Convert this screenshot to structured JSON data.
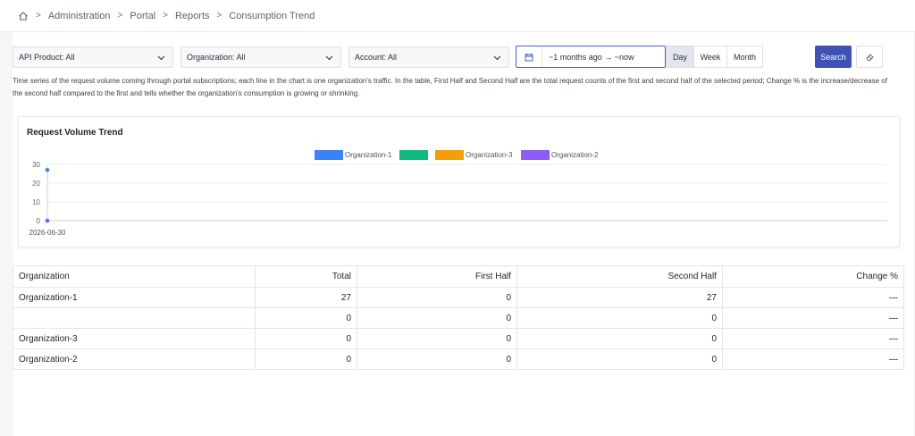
{
  "breadcrumb": {
    "home_icon": "home-icon",
    "items": [
      "Administration",
      "Portal",
      "Reports",
      "Consumption Trend"
    ]
  },
  "filters": {
    "api_product": "API Product: All",
    "organization": "Organization: All",
    "account": "Account: All",
    "date_range": "~1 months ago → ~now",
    "granularity": [
      "Day",
      "Week",
      "Month"
    ],
    "active_granularity": "Day",
    "search_label": "Search"
  },
  "description": "Time series of the request volume coming through portal subscriptions; each line in the chart is one organization's traffic. In the table, First Half and Second Half are the total request counts of the first and second half of the selected period; Change % is the increase/decrease of the second half compared to the first and tells whether the organization's consumption is growing or shrinking.",
  "chart_data": {
    "type": "line",
    "title": "Request Volume Trend",
    "x": [
      "2026-06-30"
    ],
    "yticks": [
      0,
      10,
      20,
      30
    ],
    "ylim": [
      0,
      30
    ],
    "legend_position": "top-center",
    "series": [
      {
        "name": "Organization-1",
        "values": [
          27
        ],
        "color": "#3b82f6"
      },
      {
        "name": "",
        "values": [
          0
        ],
        "color": "#10b981"
      },
      {
        "name": "Organization-3",
        "values": [
          0
        ],
        "color": "#f59e0b"
      },
      {
        "name": "Organization-2",
        "values": [
          0
        ],
        "color": "#8b5cf6"
      }
    ]
  },
  "table": {
    "headers": [
      "Organization",
      "Total",
      "First Half",
      "Second Half",
      "Change %"
    ],
    "rows": [
      [
        "Organization-1",
        "27",
        "0",
        "27",
        "—"
      ],
      [
        "",
        "0",
        "0",
        "0",
        "—"
      ],
      [
        "Organization-3",
        "0",
        "0",
        "0",
        "—"
      ],
      [
        "Organization-2",
        "0",
        "0",
        "0",
        "—"
      ]
    ]
  }
}
